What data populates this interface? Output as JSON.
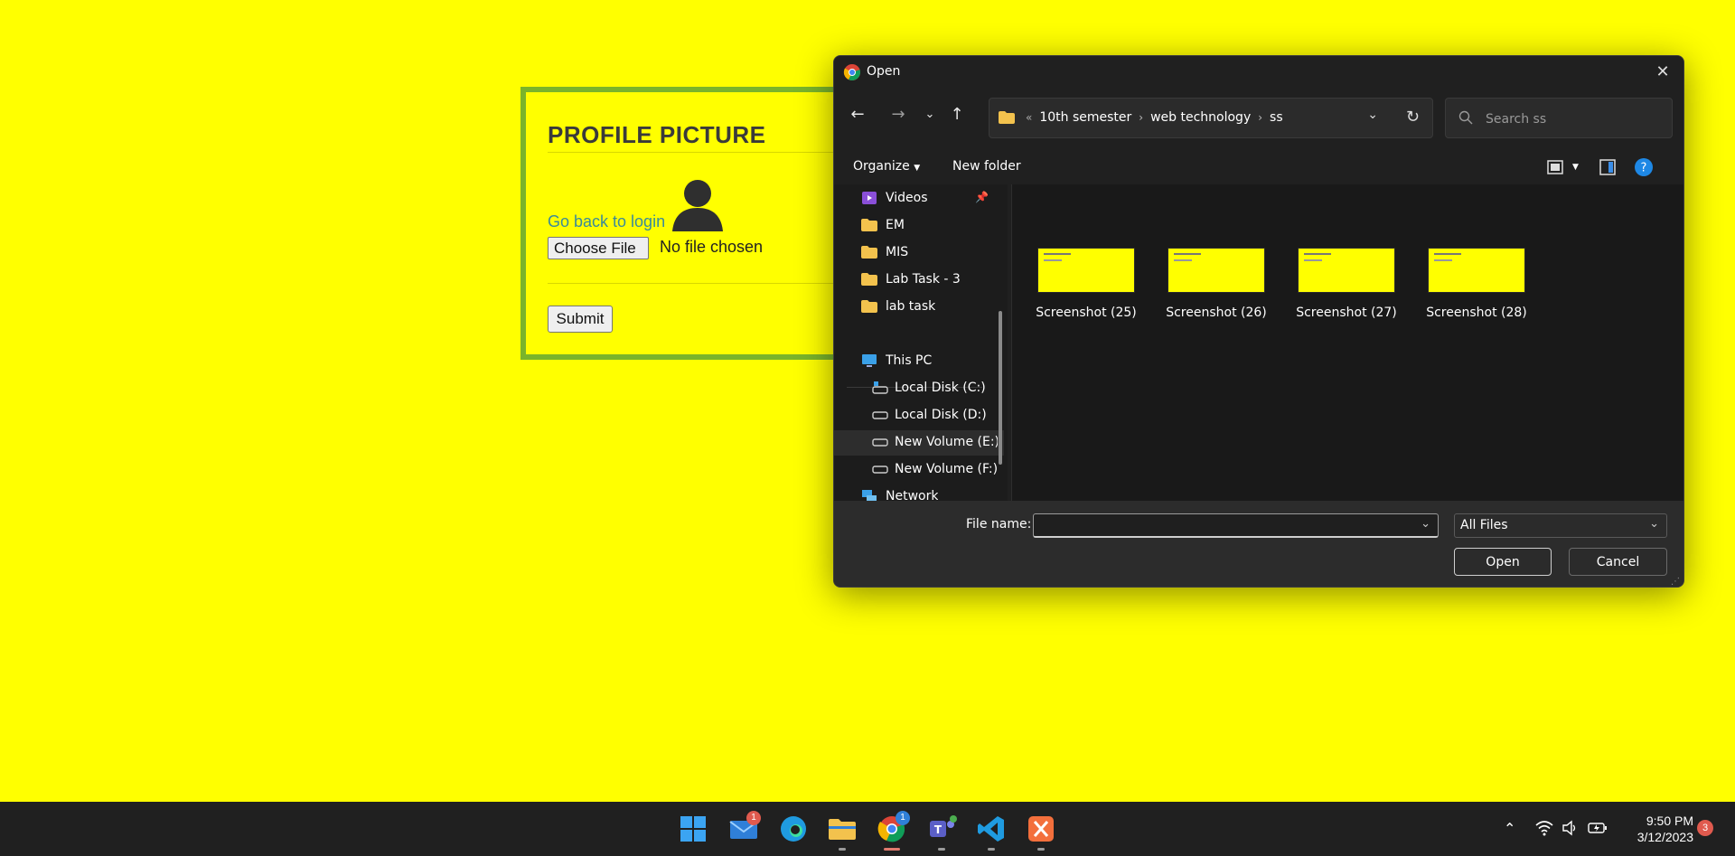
{
  "page": {
    "title": "PROFILE PICTURE",
    "back_link": "Go back to login",
    "choose_file": "Choose File",
    "no_file": "No file chosen",
    "submit": "Submit"
  },
  "dialog": {
    "title": "Open",
    "breadcrumbs": [
      "10th semester",
      "web technology",
      "ss"
    ],
    "search_placeholder": "Search ss",
    "organize": "Organize",
    "new_folder": "New folder",
    "nav_items": [
      {
        "label": "Videos",
        "icon": "videos-icon"
      },
      {
        "label": "EM",
        "icon": "folder-icon"
      },
      {
        "label": "MIS",
        "icon": "folder-icon"
      },
      {
        "label": "Lab Task - 3",
        "icon": "folder-icon"
      },
      {
        "label": "lab task",
        "icon": "folder-icon"
      },
      {
        "label": "This PC",
        "icon": "pc-icon"
      },
      {
        "label": "Local Disk (C:)",
        "icon": "drive-icon"
      },
      {
        "label": "Local Disk (D:)",
        "icon": "drive-icon"
      },
      {
        "label": "New Volume (E:)",
        "icon": "drive-icon"
      },
      {
        "label": "New Volume (F:)",
        "icon": "drive-icon"
      },
      {
        "label": "Network",
        "icon": "network-icon"
      }
    ],
    "files": [
      "Screenshot (25)",
      "Screenshot (26)",
      "Screenshot (27)",
      "Screenshot (28)"
    ],
    "file_name_label": "File name:",
    "file_name_value": "",
    "file_type": "All Files",
    "open_button": "Open",
    "cancel_button": "Cancel"
  },
  "taskbar": {
    "mail_badge": "1",
    "chrome_badge": "1",
    "time": "9:50 PM",
    "date": "3/12/2023",
    "notifications": "3"
  },
  "colors": {
    "page_bg": "#ffff00",
    "card_border": "#7ab42a",
    "dialog_bg": "#202020",
    "taskbar_bg": "#202020"
  }
}
